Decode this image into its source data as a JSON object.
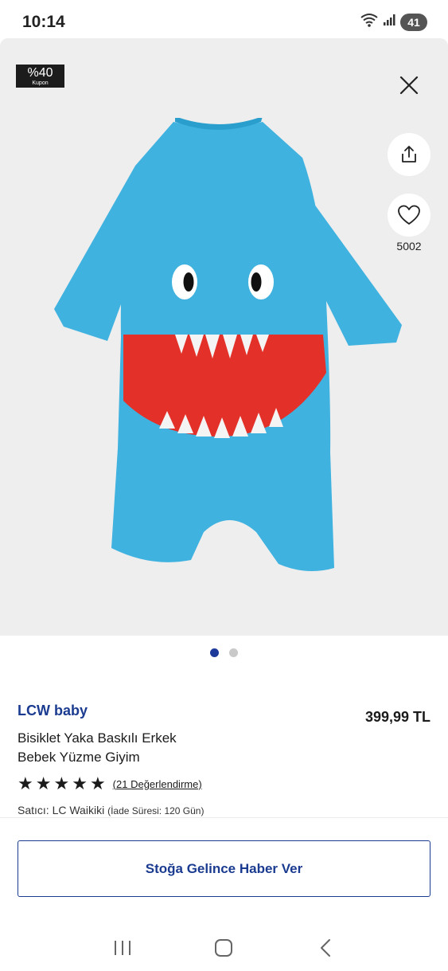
{
  "status_bar": {
    "time": "10:14",
    "battery": "41",
    "icons": [
      "wifi-icon",
      "signal-icon",
      "battery-icon"
    ]
  },
  "gallery": {
    "coupon": {
      "percent": "%40",
      "label": "Kupon"
    },
    "favorite_count": "5002",
    "page_count": 2,
    "active_page": 1,
    "icons": [
      "close-icon",
      "share-icon",
      "heart-icon"
    ]
  },
  "product": {
    "brand": "LCW baby",
    "price": "399,99 TL",
    "title_line1": "Bisiklet Yaka Baskılı Erkek",
    "title_line2": "Bebek Yüzme Giyim",
    "rating": 5,
    "reviews": "(21 Değerlendirme)",
    "seller_prefix": "Satıcı:",
    "seller_name": "LC Waikiki",
    "return_policy": "(İade Süresi: 120 Gün)"
  },
  "actions": {
    "notify_label": "Stoğa Gelince Haber Ver"
  },
  "colors": {
    "brand": "#1a3b8f",
    "active_dot": "#1d3a9a",
    "garment": "#3fb2e0",
    "mouth": "#e3312a"
  },
  "nav": [
    "recents-icon",
    "home-icon",
    "back-icon"
  ]
}
